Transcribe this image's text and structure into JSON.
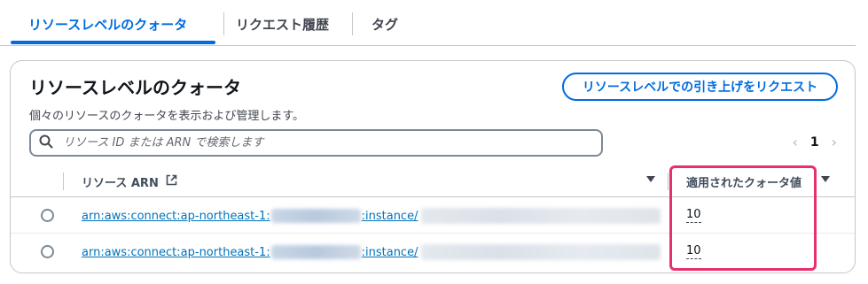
{
  "tabs": [
    {
      "label": "リソースレベルのクォータ",
      "active": true
    },
    {
      "label": "リクエスト履歴",
      "active": false
    },
    {
      "label": "タグ",
      "active": false
    }
  ],
  "card": {
    "title": "リソースレベルのクォータ",
    "description": "個々のリソースのクォータを表示および管理します。",
    "request_button": "リソースレベルでの引き上げをリクエスト"
  },
  "search": {
    "placeholder": "リソース ID または ARN で検索します"
  },
  "pagination": {
    "prev": "‹",
    "current": "1",
    "next": "›"
  },
  "table": {
    "columns": [
      "リソース ARN",
      "適用されたクォータ値"
    ],
    "rows": [
      {
        "arn_prefix": "arn:aws:connect:ap-northeast-1:",
        "arn_middle": ":instance/",
        "quota": "10"
      },
      {
        "arn_prefix": "arn:aws:connect:ap-northeast-1:",
        "arn_middle": ":instance/",
        "quota": "10"
      }
    ]
  },
  "colors": {
    "accent": "#006ce0",
    "highlight": "#e8306c",
    "link": "#0073bb"
  }
}
